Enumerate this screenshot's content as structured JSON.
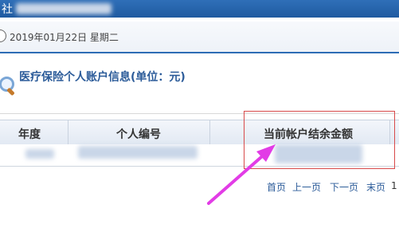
{
  "window": {
    "title": "社"
  },
  "date_bar": {
    "date_text": "2019年01月22日 星期二"
  },
  "section": {
    "title": "医疗保险个人账户信息(单位：元)"
  },
  "table": {
    "headers": [
      "年度",
      "个人编号",
      "当前帐户结余金额"
    ]
  },
  "pager": {
    "first": "首页",
    "prev": "上一页",
    "next": "下一页",
    "last": "末页",
    "page_indicator": "1"
  },
  "colors": {
    "topbar": "#1f5aa0",
    "accent": "#2b5b99",
    "annotation_box": "#d84a4a",
    "annotation_arrow": "#e23ce6"
  },
  "icons": [
    "clock-icon",
    "magnifier-icon"
  ]
}
